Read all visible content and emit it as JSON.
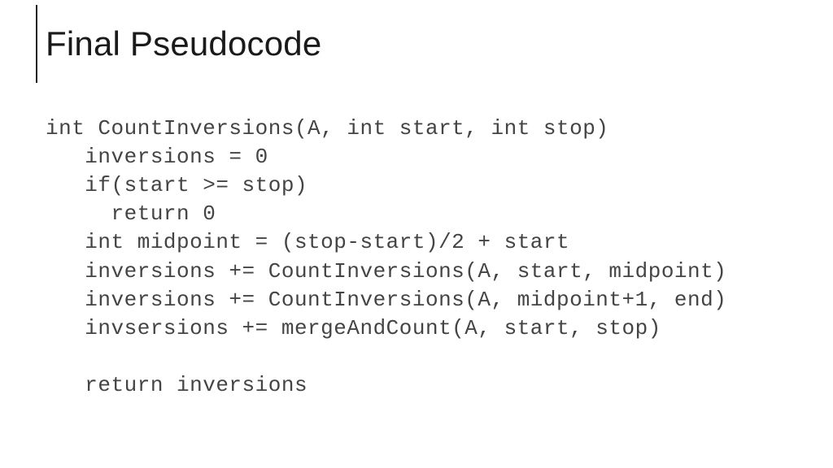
{
  "title": "Final Pseudocode",
  "code": {
    "l1": "int CountInversions(A, int start, int stop)",
    "l2": "   inversions = 0",
    "l3": "   if(start >= stop)",
    "l4": "     return 0",
    "l5": "   int midpoint = (stop-start)/2 + start",
    "l6": "   inversions += CountInversions(A, start, midpoint)",
    "l7": "   inversions += CountInversions(A, midpoint+1, end)",
    "l8": "   invsersions += mergeAndCount(A, start, stop)",
    "l9": "",
    "l10": "   return inversions"
  }
}
